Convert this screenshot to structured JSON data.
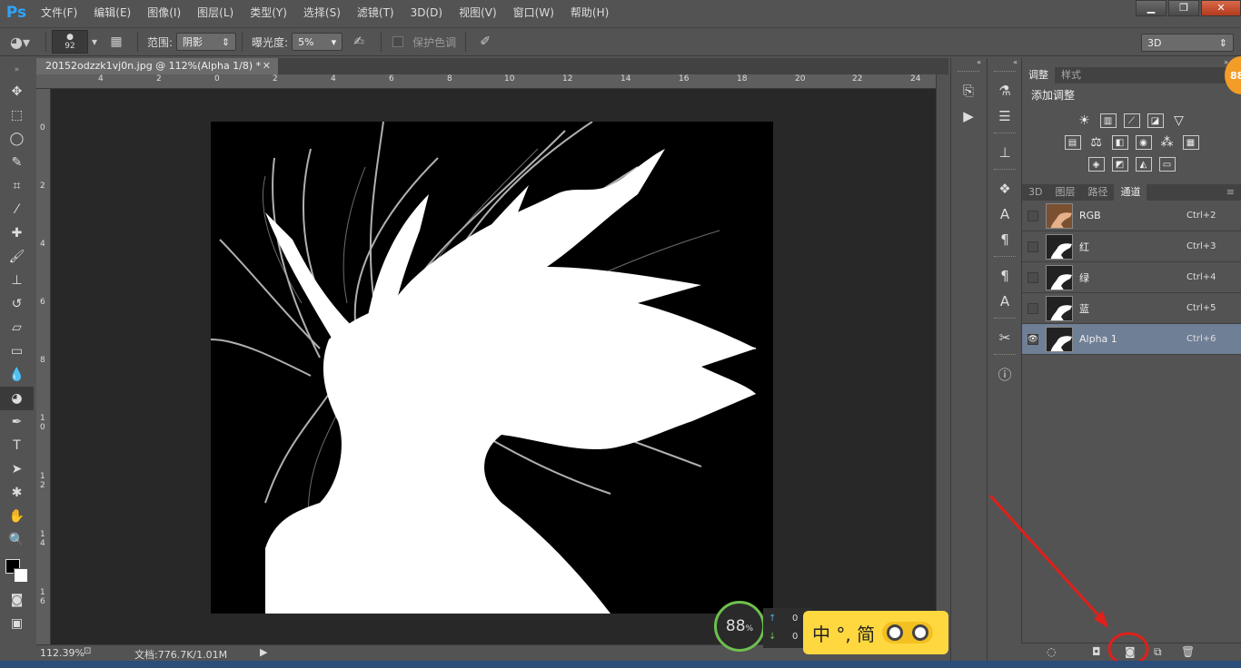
{
  "app": {
    "logo": "Ps"
  },
  "menu": [
    "文件(F)",
    "编辑(E)",
    "图像(I)",
    "图层(L)",
    "类型(Y)",
    "选择(S)",
    "滤镜(T)",
    "3D(D)",
    "视图(V)",
    "窗口(W)",
    "帮助(H)"
  ],
  "options": {
    "brush_size": "92",
    "range_label": "范围:",
    "range_value": "阴影",
    "exposure_label": "曝光度:",
    "exposure_value": "5%",
    "protect_tones": "保护色调",
    "workspace": "3D"
  },
  "document": {
    "tab_title": "20152odzzk1vj0n.jpg @ 112%(Alpha 1/8) *",
    "zoom": "112.39%",
    "doc_size": "文档:776.7K/1.01M"
  },
  "ruler": {
    "top": [
      "4",
      "2",
      "0",
      "2",
      "4",
      "6",
      "8",
      "10",
      "12",
      "14",
      "16",
      "18",
      "20",
      "22",
      "24"
    ],
    "left": [
      "0",
      "2",
      "4",
      "6",
      "8",
      "1 0",
      "1 2",
      "1 4",
      "1 6"
    ]
  },
  "panels": {
    "adjust_tabs": [
      "调整",
      "样式"
    ],
    "add_adjustment": "添加调整",
    "layer_tabs": [
      "3D",
      "图层",
      "路径",
      "通道"
    ],
    "channels": [
      {
        "name": "RGB",
        "shortcut": "Ctrl+2",
        "visible": false,
        "active": false
      },
      {
        "name": "红",
        "shortcut": "Ctrl+3",
        "visible": false,
        "active": false
      },
      {
        "name": "绿",
        "shortcut": "Ctrl+4",
        "visible": false,
        "active": false
      },
      {
        "name": "蓝",
        "shortcut": "Ctrl+5",
        "visible": false,
        "active": false
      },
      {
        "name": "Alpha 1",
        "shortcut": "Ctrl+6",
        "visible": true,
        "active": true
      }
    ]
  },
  "overlay": {
    "meter": "88",
    "meter_unit": "%",
    "net_up": "0",
    "net_down": "0",
    "ime": "中 °, 简",
    "badge": "88"
  },
  "colors": {
    "annotation": "#e0201a",
    "ps_blue": "#2fa3f7",
    "active_channel": "#6f7f96"
  }
}
